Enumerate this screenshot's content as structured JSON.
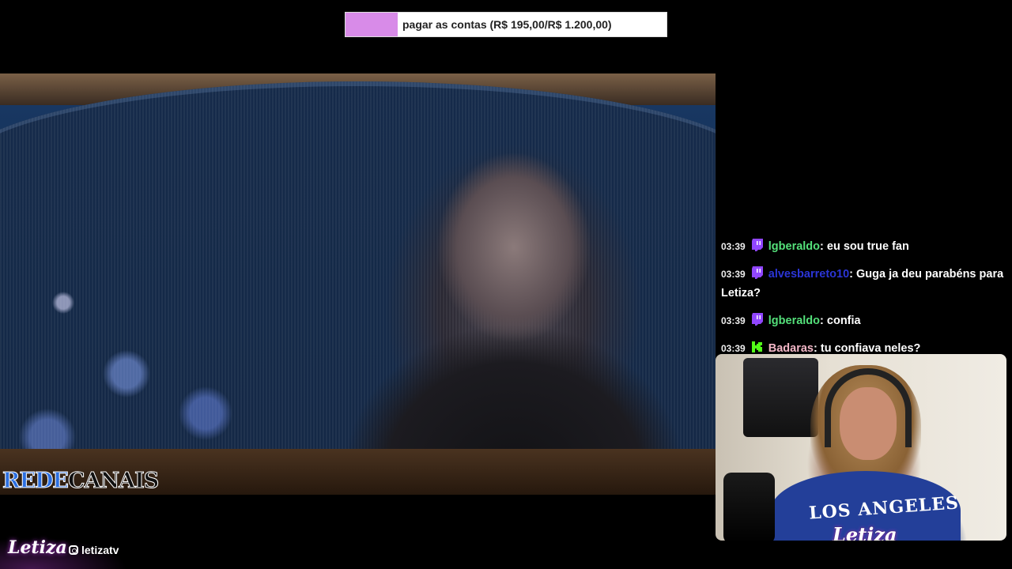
{
  "goal": {
    "text": "pagar as contas (R$ 195,00/R$ 1.200,00)",
    "progress_fraction": 0.1625,
    "fill_color": "#d88be8"
  },
  "watermark": {
    "part1": "REDE",
    "part2": "CANAIS"
  },
  "chat": [
    {
      "time": "03:39",
      "badge": "twitch-icon",
      "user": "lgberaldo",
      "sep": ":",
      "message": "eu sou true fan",
      "user_color": "#54e07a"
    },
    {
      "time": "03:39",
      "badge": "twitch-icon",
      "user": "alvesbarreto10",
      "sep": ":",
      "message": "Guga ja deu parabéns para Letiza?",
      "user_color": "#2b35d6"
    },
    {
      "time": "03:39",
      "badge": "twitch-icon",
      "user": "lgberaldo",
      "sep": ":",
      "message": "confia",
      "user_color": "#54e07a"
    },
    {
      "time": "03:39",
      "badge": "kick-icon",
      "user": "Badaras",
      "sep": ":",
      "message": "tu confiava neles?",
      "user_color": "#f2b6c6"
    }
  ],
  "webcam": {
    "shirt_text": "LOS ANGELES",
    "logo": "Letiza"
  },
  "footer": {
    "logo": "Letiza",
    "instagram": "letizatv"
  }
}
